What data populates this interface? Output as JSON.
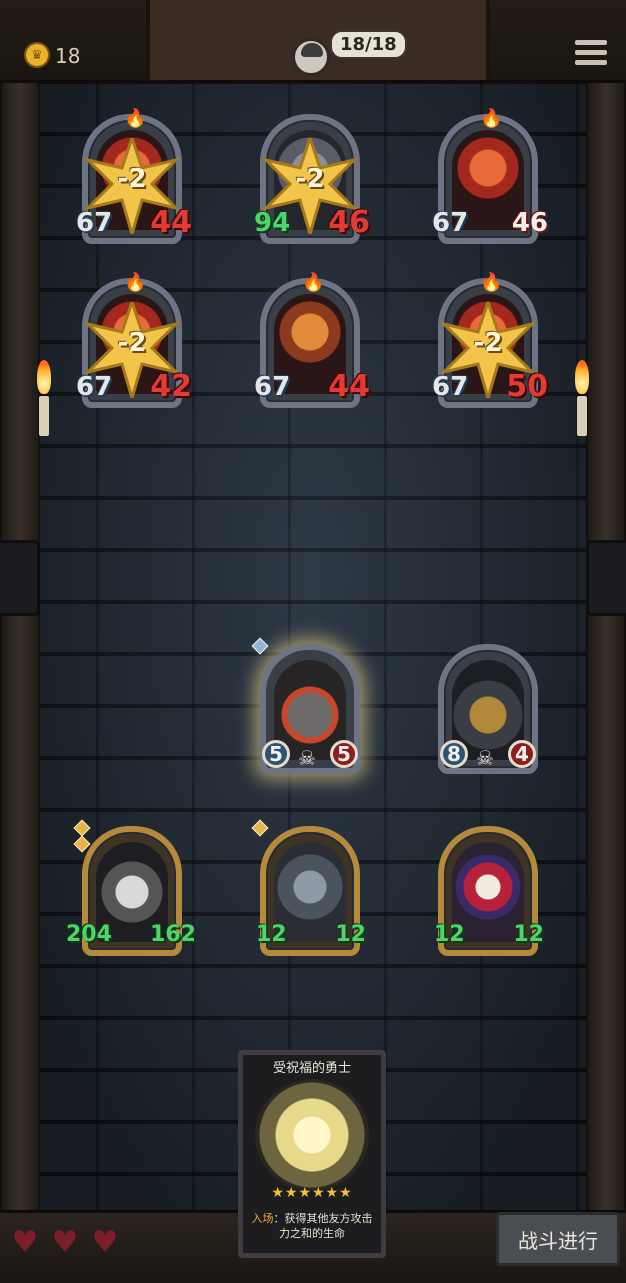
{
  "header": {
    "gold": "18",
    "player_hp": "18/18"
  },
  "enemy_cards": [
    {
      "name": "devil-1",
      "atk": "67",
      "hp": "44",
      "hp_damaged": true,
      "damage_popup": "-2"
    },
    {
      "name": "knight",
      "atk": "94",
      "hp": "46",
      "hp_damaged": true,
      "atk_buffed": true,
      "damage_popup": "-2"
    },
    {
      "name": "devil-3",
      "atk": "67",
      "hp": "46",
      "hp_damaged": false,
      "damage_popup": ""
    },
    {
      "name": "devil-4",
      "atk": "67",
      "hp": "42",
      "hp_damaged": true,
      "damage_popup": "-2"
    },
    {
      "name": "devil-5",
      "atk": "67",
      "hp": "44",
      "hp_damaged": true,
      "damage_popup": ""
    },
    {
      "name": "devil-6",
      "atk": "67",
      "hp": "50",
      "hp_damaged": true,
      "damage_popup": "-2"
    }
  ],
  "ally_front": [
    {
      "name": "fire-beast",
      "atk": "5",
      "hp": "5"
    },
    {
      "name": "drill-machine",
      "atk": "8",
      "hp": "4"
    }
  ],
  "ally_back": [
    {
      "name": "cat-sage",
      "atk": "204",
      "hp": "162"
    },
    {
      "name": "robot",
      "atk": "12",
      "hp": "12"
    },
    {
      "name": "clown",
      "atk": "12",
      "hp": "12"
    }
  ],
  "hand_card": {
    "title": "受祝福的勇士",
    "stars": "★★★★★★",
    "keyword": "入场",
    "description_after_keyword": "：获得其他友方攻击力之和的生命"
  },
  "lives": 3,
  "battle_button": "战斗进行",
  "colors": {
    "damage_red": "#e23a34",
    "buff_green": "#4fd46a",
    "gold_frame": "#b68a3b"
  }
}
